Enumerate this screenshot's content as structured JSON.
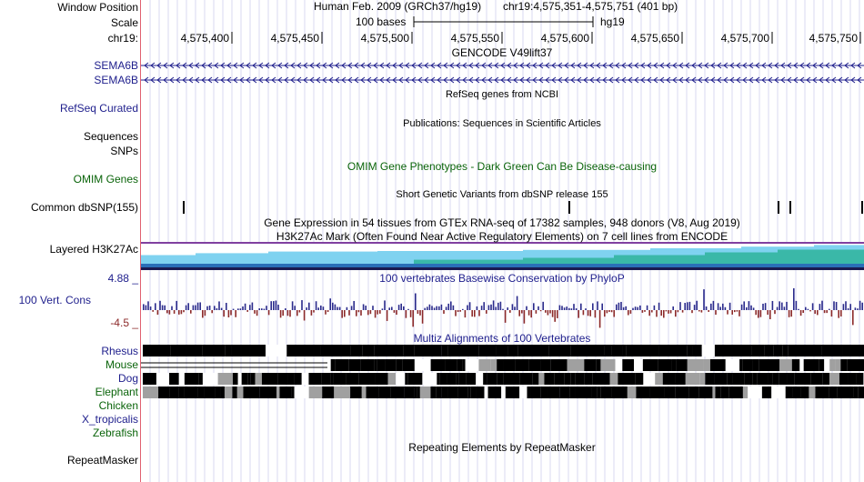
{
  "header": {
    "window_position_label": "Window Position",
    "scale_label": "Scale",
    "chrom_label": "chr19:",
    "assembly_text": "Human Feb. 2009 (GRCh37/hg19)",
    "position_text": "chr19:4,575,351-4,575,751 (401 bp)",
    "scale_text": "100 bases",
    "scale_db": "hg19",
    "ticks": [
      "4,575,400",
      "4,575,450",
      "4,575,500",
      "4,575,550",
      "4,575,600",
      "4,575,650",
      "4,575,700",
      "4,575,750"
    ]
  },
  "tracks": {
    "gencode": {
      "title": "GENCODE V49lift37",
      "items": [
        "SEMA6B",
        "SEMA6B"
      ]
    },
    "refseq": {
      "title": "RefSeq genes from NCBI",
      "label": "RefSeq Curated"
    },
    "publications": {
      "title": "Publications: Sequences in Scientific Articles",
      "labels": [
        "Sequences",
        "SNPs"
      ]
    },
    "omim": {
      "title": "OMIM Gene Phenotypes - Dark Green Can Be Disease-causing",
      "label": "OMIM Genes"
    },
    "dbsnp": {
      "title": "Short Genetic Variants from dbSNP release 155",
      "label": "Common dbSNP(155)"
    },
    "gtex": {
      "title": "Gene Expression in 54 tissues from GTEx RNA-seq of 17382 samples, 948 donors (V8, Aug 2019)"
    },
    "h3k27ac": {
      "title": "H3K27Ac Mark (Often Found Near Active Regulatory Elements) on 7 cell lines from ENCODE",
      "label": "Layered H3K27Ac"
    },
    "phylop": {
      "title": "100 vertebrates Basewise Conservation by PhyloP",
      "label": "100 Vert. Cons",
      "max_label": "4.88 _",
      "min_label": "-4.5 _",
      "max": 4.88,
      "min": -4.5
    },
    "multiz": {
      "title": "Multiz Alignments of 100 Vertebrates",
      "species": [
        {
          "name": "Rhesus",
          "color": "#1e1e8c"
        },
        {
          "name": "Mouse",
          "color": "#0a640a"
        },
        {
          "name": "Dog",
          "color": "#1e1e8c"
        },
        {
          "name": "Elephant",
          "color": "#0a640a"
        },
        {
          "name": "Chicken",
          "color": "#0a640a"
        },
        {
          "name": "X_tropicalis",
          "color": "#1e1e8c"
        },
        {
          "name": "Zebrafish",
          "color": "#0a640a"
        }
      ]
    },
    "repeatmasker": {
      "title": "Repeating Elements by RepeatMasker",
      "label": "RepeatMasker"
    }
  },
  "colors": {
    "navy": "#1e1e8c",
    "green": "#0a640a",
    "phylop_pos": "#2a2a8c",
    "phylop_neg": "#8c2a2a",
    "divider": "#e06070",
    "grid": "#d8d8f0"
  }
}
